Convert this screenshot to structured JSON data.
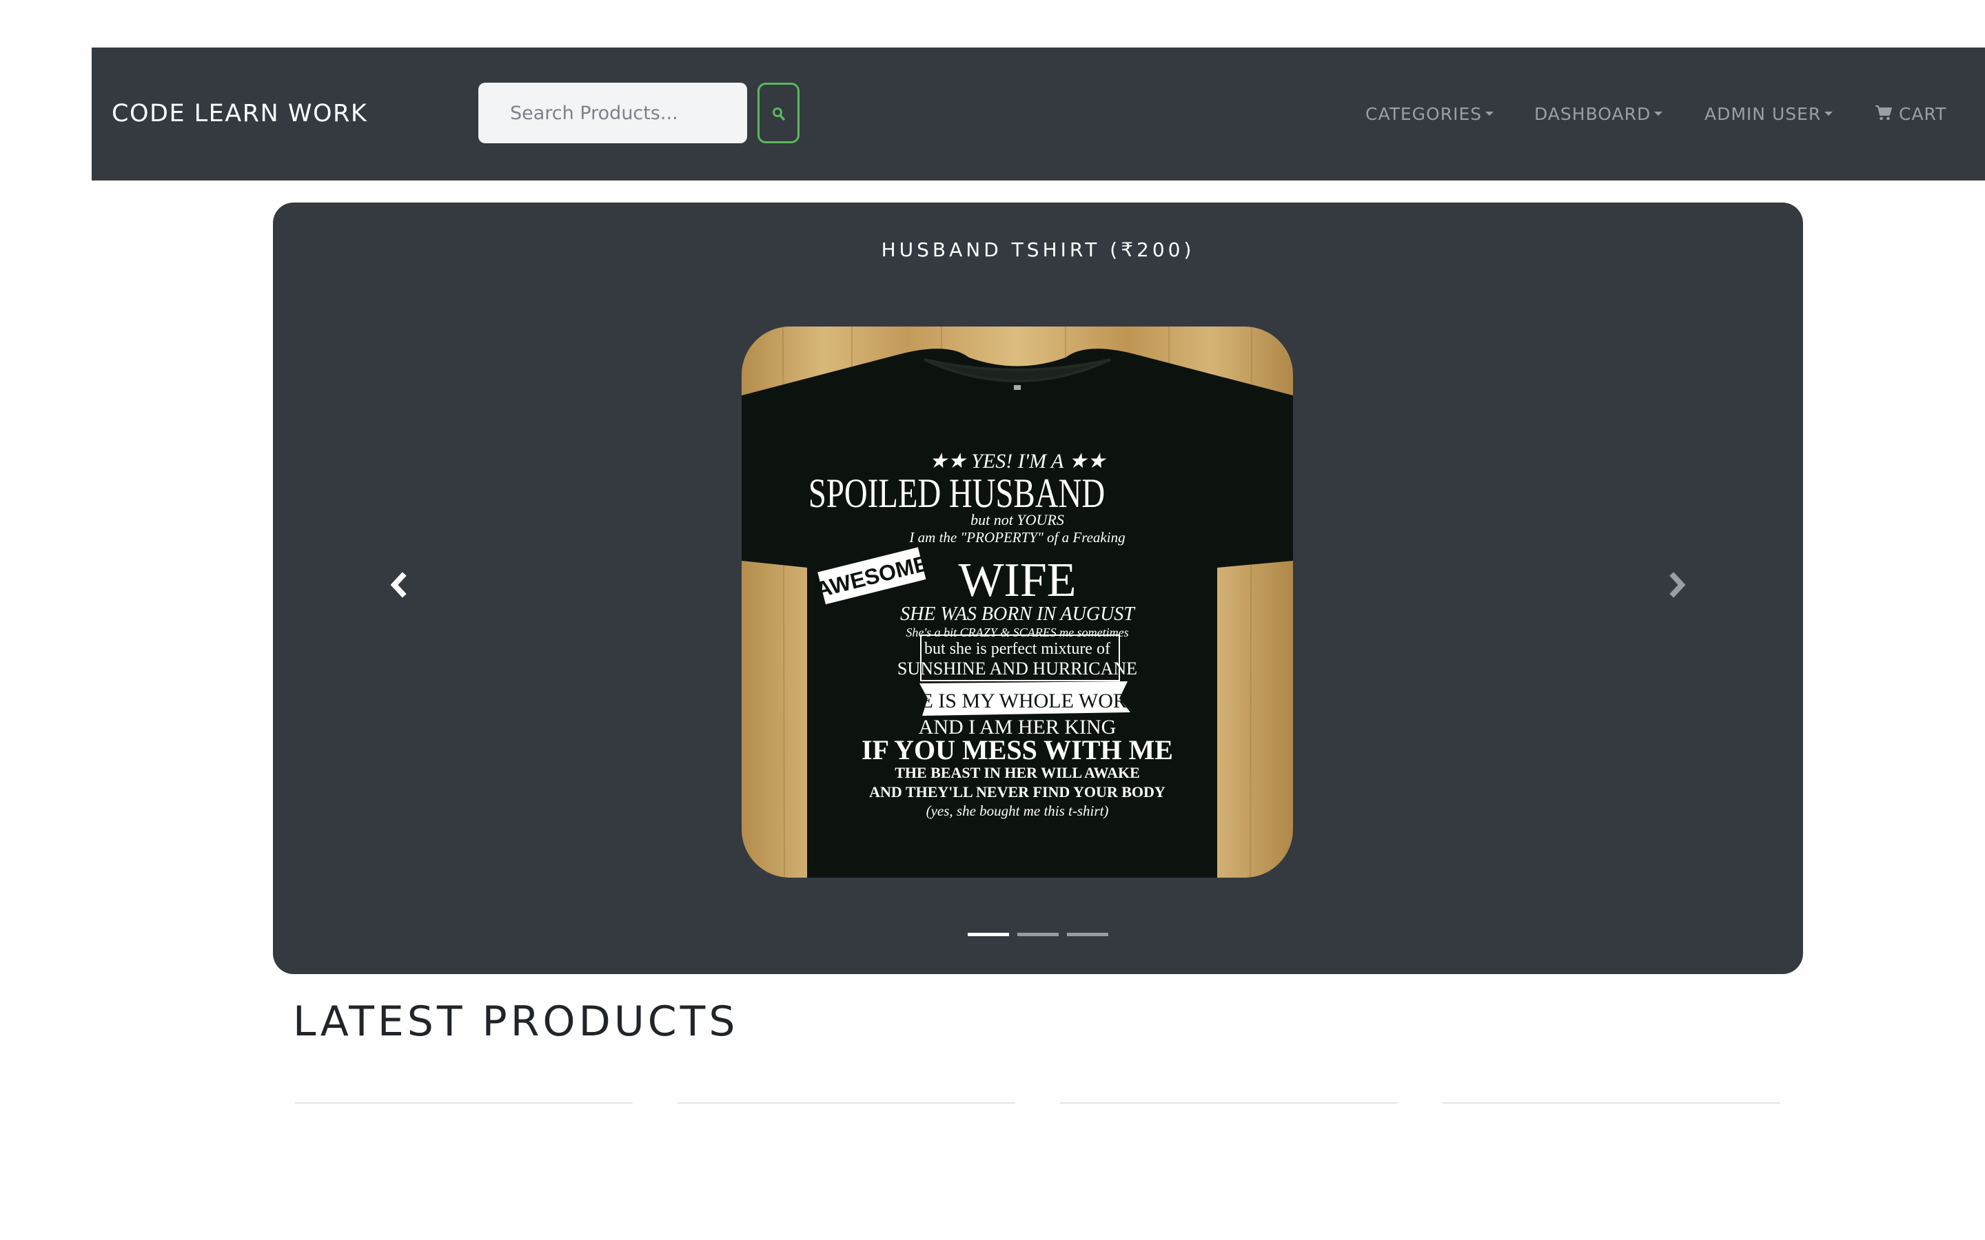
{
  "navbar": {
    "brand": "CODE LEARN WORK",
    "search_placeholder": "Search Products...",
    "search_button_icon": "search-icon",
    "items": [
      {
        "label": "CATEGORIES",
        "dropdown": true
      },
      {
        "label": "DASHBOARD",
        "dropdown": true
      },
      {
        "label": "ADMIN USER",
        "dropdown": true
      },
      {
        "label": "CART",
        "icon": "cart-icon"
      }
    ],
    "accent_color": "#5cb85c",
    "background_color": "#343a40"
  },
  "carousel": {
    "caption": "HUSBAND TSHIRT (₹200)",
    "prev_icon": "chevron-left-icon",
    "next_icon": "chevron-right-icon",
    "indicator_count": 3,
    "active_index": 0,
    "image": {
      "lines": [
        "★★ YES! I'M A ★★",
        "SPOILED HUSBAND",
        "but not YOURS",
        "I am the \"PROPERTY\" of a Freaking",
        "AWESOME",
        "WIFE",
        "SHE WAS BORN IN AUGUST",
        "She's a bit CRAZY & SCARES me sometimes",
        "but she is perfect mixture of",
        "SUNSHINE AND HURRICANE",
        "SHE IS MY WHOLE WORLD",
        "AND I AM HER KING",
        "IF YOU MESS WITH ME",
        "THE BEAST IN HER WILL AWAKE",
        "AND THEY'LL NEVER FIND YOUR BODY",
        "(yes, she bought me this t-shirt)"
      ]
    }
  },
  "latest_products": {
    "title": "LATEST PRODUCTS"
  }
}
